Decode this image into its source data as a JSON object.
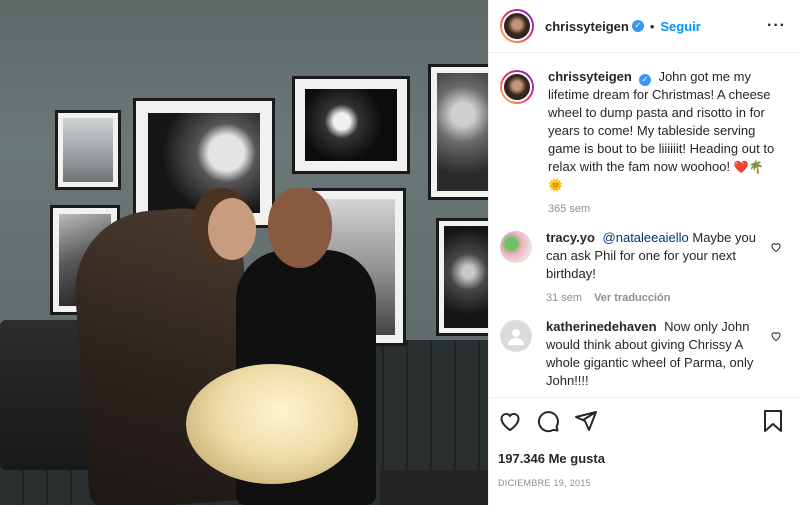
{
  "post": {
    "username": "chrissyteigen",
    "follow_label": "Seguir",
    "separator": "•",
    "more_label": "···"
  },
  "caption": {
    "username": "chrissyteigen",
    "text": "John got me my lifetime dream for Christmas! A cheese wheel to dump pasta and risotto in for years to come! My tableside serving game is bout to be liiiiiit! Heading out to relax with the fam now woohoo!",
    "emojis": "❤️🌴🌞",
    "time": "365 sem"
  },
  "comments": [
    {
      "username": "tracy.yo",
      "mention": "@nataleeaiello",
      "text": "Maybe you can ask Phil for one for your next birthday!",
      "time": "31 sem",
      "translate_label": "Ver traducción"
    },
    {
      "username": "katherinedehaven",
      "text": "Now only John would think about giving Chrissy A whole gigantic wheel of Parma, only John!!!!"
    }
  ],
  "actions": {
    "likes": "197.346 Me gusta",
    "date": "Diciembre 19, 2015"
  },
  "colors": {
    "accent": "#0095f6",
    "verified": "#3897f0",
    "heart": "#ed4956"
  }
}
